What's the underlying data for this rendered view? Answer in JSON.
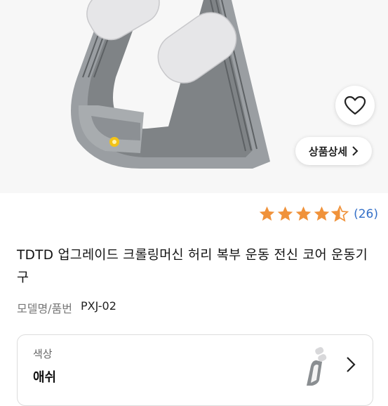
{
  "product": {
    "detail_button_label": "상품상세",
    "rating": 4.5,
    "rating_max": 5,
    "review_count_text": "(26)",
    "title": "TDTD 업그레이드 크롤링머신 허리 복부 운동 전신 코어 운동기구",
    "model_label": "모델명/품번",
    "model_value": "PXJ-02"
  },
  "option": {
    "label": "색상",
    "value": "애쉬"
  },
  "icons": {
    "wishlist": "heart-outline-icon",
    "detail": "chevron-right-icon",
    "option": "chevron-right-icon"
  },
  "colors": {
    "star": "#f0923a",
    "review_count": "#3470c8",
    "machine_body": "#8a8e91",
    "pad": "#e6e6e8",
    "led": "#f3c317"
  }
}
